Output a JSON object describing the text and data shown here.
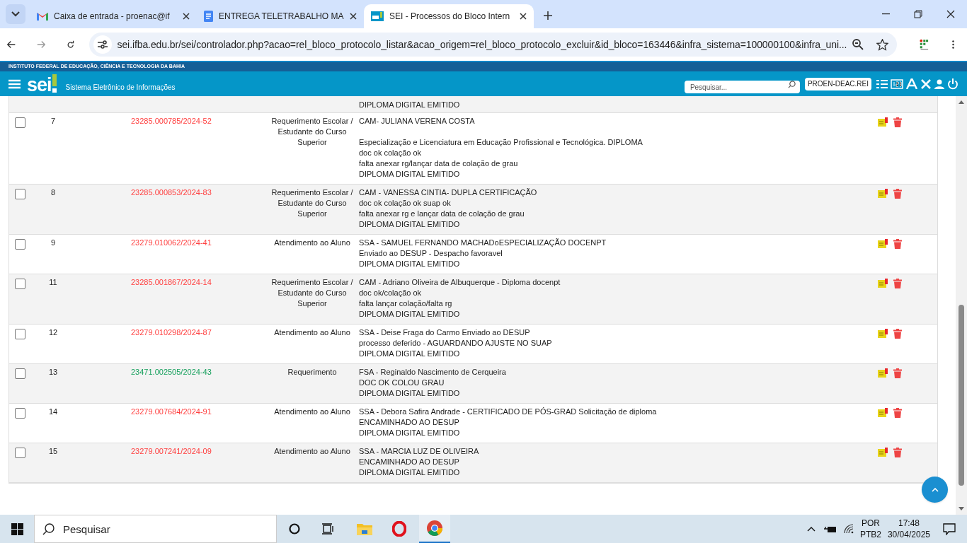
{
  "browser": {
    "tabs": [
      {
        "title": "Caixa de entrada - proenac@if",
        "selected": false
      },
      {
        "title": "ENTREGA TELETRABALHO MA",
        "selected": false
      },
      {
        "title": "SEI - Processos do Bloco Intern",
        "selected": true
      }
    ],
    "url": "sei.ifba.edu.br/sei/controlador.php?acao=rel_bloco_protocolo_listar&acao_origem=rel_bloco_protocolo_excluir&id_bloco=163446&infra_sistema=100000100&infra_uni..."
  },
  "header": {
    "institution": "INSTITUTO FEDERAL DE EDUCAÇÃO, CIÊNCIA E TECNOLOGIA DA BAHIA",
    "logo": "sei",
    "system_name": "Sistema Eletrônico de Informações",
    "search_placeholder": "Pesquisar...",
    "unit": "PROEN-DEAC.REI"
  },
  "table": {
    "partial_row": {
      "description": "DIPLOMA DIGITAL EMITIDO"
    },
    "rows": [
      {
        "checked": false,
        "seq": "7",
        "protocol": "23285.000785/2024-52",
        "color": "#ff4040",
        "type": "Requerimento Escolar / Estudante do Curso Superior",
        "description": "CAM- JULIANA VERENA COSTA\n\nEspecialização e Licenciatura em Educação Profissional e Tecnológica. DIPLOMA\ndoc ok colação ok\nfalta anexar rg/lançar data de colação de grau\nDIPLOMA DIGITAL EMITIDO"
      },
      {
        "checked": false,
        "seq": "8",
        "protocol": "23285.000853/2024-83",
        "color": "#ff4040",
        "type": "Requerimento Escolar / Estudante do Curso Superior",
        "description": "CAM - VANESSA CINTIA- DUPLA CERTIFICAÇÃO\ndoc ok colação ok suap ok\nfalta anexar rg e lançar data de colação de grau\nDIPLOMA DIGITAL EMITIDO"
      },
      {
        "checked": false,
        "seq": "9",
        "protocol": "23279.010062/2024-41",
        "color": "#ff4040",
        "type": "Atendimento ao Aluno",
        "description": "SSA - SAMUEL FERNANDO MACHADoESPECIALIZAÇÃO DOCENPT\nEnviado ao DESUP - Despacho favoravel\nDIPLOMA DIGITAL EMITIDO"
      },
      {
        "checked": false,
        "seq": "11",
        "protocol": "23285.001867/2024-14",
        "color": "#ff4040",
        "type": "Requerimento Escolar / Estudante do Curso Superior",
        "description": "CAM - Adriano Oliveira de Albuquerque - Diploma docenpt\ndoc ok/colação ok\nfalta lançar colação/falta rg\nDIPLOMA DIGITAL EMITIDO"
      },
      {
        "checked": false,
        "seq": "12",
        "protocol": "23279.010298/2024-87",
        "color": "#ff4040",
        "type": "Atendimento ao Aluno",
        "description": "SSA - Deise Fraga do Carmo Enviado ao DESUP\nprocesso deferido - AGUARDANDO AJUSTE NO SUAP\nDIPLOMA DIGITAL EMITIDO"
      },
      {
        "checked": false,
        "seq": "13",
        "protocol": "23471.002505/2024-43",
        "color": "#17a05d",
        "type": "Requerimento",
        "description": "FSA - Reginaldo Nascimento de Cerqueira\nDOC OK COLOU GRAU\nDIPLOMA DIGITAL EMITIDO"
      },
      {
        "checked": false,
        "seq": "14",
        "protocol": "23279.007684/2024-91",
        "color": "#ff4040",
        "type": "Atendimento ao Aluno",
        "description": "SSA - Debora Safira Andrade - CERTIFICADO DE PÓS-GRAD Solicitação de diploma\nENCAMINHADO AO DESUP\nDIPLOMA DIGITAL EMITIDO"
      },
      {
        "checked": false,
        "seq": "15",
        "protocol": "23279.007241/2024-09",
        "color": "#ff4040",
        "type": "Atendimento ao Aluno",
        "description": "SSA - MARCIA LUZ DE OLIVEIRA\nENCAMINHADO AO DESUP\nDIPLOMA DIGITAL EMITIDO"
      }
    ]
  },
  "taskbar": {
    "search_placeholder": "Pesquisar",
    "language": "POR",
    "layout": "PTB2",
    "time": "17:48",
    "date": "30/04/2025"
  }
}
